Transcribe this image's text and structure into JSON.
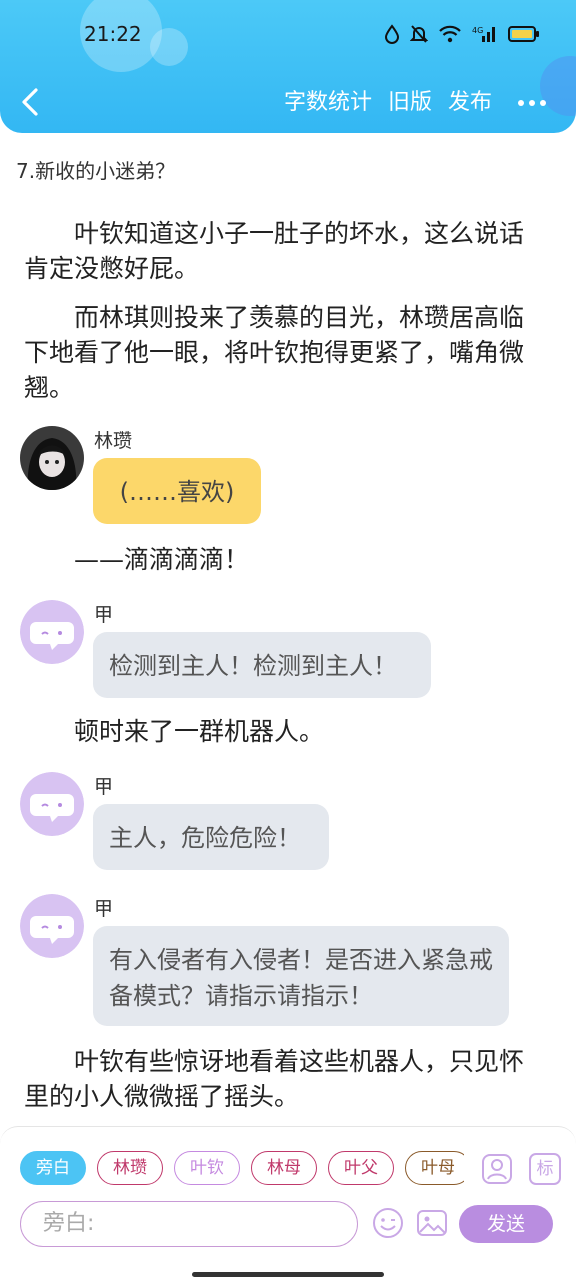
{
  "status_bar": {
    "time": "21:22"
  },
  "header": {
    "word_count": "字数统计",
    "old_version": "旧版",
    "publish": "发布"
  },
  "chapter_title": "7.新收的小迷弟？",
  "content": {
    "para1": "叶钦知道这小子一肚子的坏水，这么说话肯定没憋好屁。",
    "para2": "而林琪则投来了羡慕的目光，林瓒居高临下地看了他一眼，将叶钦抱得更紧了，嘴角微翘。",
    "msg1": {
      "speaker": "林瓒",
      "text": "(……喜欢)"
    },
    "narr1": "——滴滴滴滴！",
    "msg2": {
      "speaker": "甲",
      "text": "检测到主人！检测到主人！"
    },
    "narr2": "顿时来了一群机器人。",
    "msg3": {
      "speaker": "甲",
      "text": "主人，危险危险！"
    },
    "msg4": {
      "speaker": "甲",
      "text": "有入侵者有入侵者！是否进入紧急戒备模式？请指示请指示！"
    },
    "para3": "叶钦有些惊讶地看着这些机器人，只见怀里的小人微微摇了摇头。"
  },
  "bottom": {
    "chips": [
      {
        "label": "旁白",
        "color": "#4cc4f4"
      },
      {
        "label": "林瓒",
        "color": "#c0396b"
      },
      {
        "label": "叶钦",
        "color": "#c58ae0"
      },
      {
        "label": "林母",
        "color": "#c0396b"
      },
      {
        "label": "叶父",
        "color": "#c0396b"
      },
      {
        "label": "叶母",
        "color": "#8a5a2a"
      }
    ],
    "input_placeholder": "旁白:",
    "send_label": "发送",
    "tag_label": "标"
  },
  "colors": {
    "header": "#33b7f3",
    "accent_purple": "#b98de0",
    "bubble_gray": "#e4e8ee",
    "bubble_yellow": "#fcd76a"
  }
}
